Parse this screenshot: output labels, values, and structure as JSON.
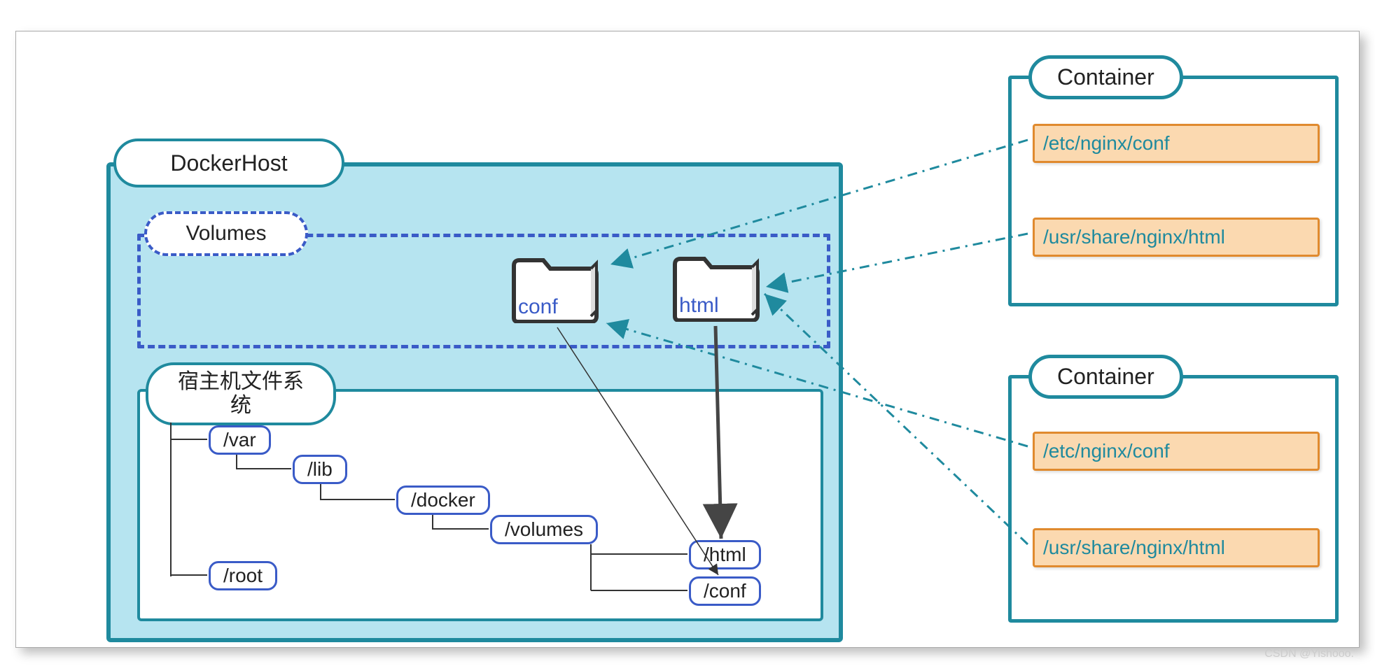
{
  "dockerhost": {
    "title": "DockerHost"
  },
  "volumes": {
    "title": "Volumes",
    "folders": {
      "conf": "conf",
      "html": "html"
    }
  },
  "hostfs": {
    "title": "宿主机文件系\n统",
    "nodes": {
      "var": "/var",
      "lib": "/lib",
      "docker": "/docker",
      "volumes": "/volumes",
      "html": "/html",
      "conf": "/conf",
      "root": "/root"
    }
  },
  "containers": [
    {
      "title": "Container",
      "paths": [
        "/etc/nginx/conf",
        "/usr/share/nginx/html"
      ]
    },
    {
      "title": "Container",
      "paths": [
        "/etc/nginx/conf",
        "/usr/share/nginx/html"
      ]
    }
  ],
  "watermark": "CSDN @Yishooo.",
  "colors": {
    "teal": "#1f8a9e",
    "blue": "#3a5bc7",
    "lightteal": "#b6e4f0",
    "orangeFill": "#fbd9b0",
    "orangeBorder": "#e08a2e"
  }
}
